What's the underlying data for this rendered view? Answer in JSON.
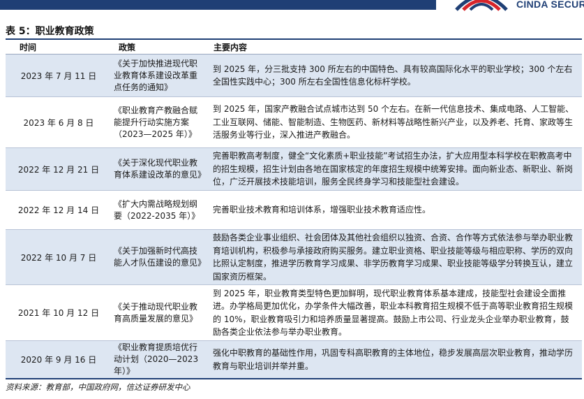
{
  "header": {
    "logo_text": "CINDA SECUR",
    "brand_colors": {
      "navy": "#1f3f75",
      "red": "#d7252b"
    }
  },
  "table": {
    "title": "表 5：职业教育政策",
    "columns": [
      "时间",
      "政策",
      "主要内容"
    ],
    "rows": [
      {
        "date": "2023 年 7 月 11 日",
        "policy": "《关于加快推进现代职业教育体系建设改革重点任务的通知》",
        "content": "到 2025 年，分三批支持 300 所左右的中国特色、具有较高国际化水平的职业学校；300 个左右全国性实践中心；300 所左右全国性信息化标杆学校。"
      },
      {
        "date": "2023 年 6 月 8 日",
        "policy": "《职业教育产教融合赋能提升行动实施方案（2023—2025 年）》",
        "content": "到 2025 年，国家产教融合试点城市达到 50 个左右。在新一代信息技术、集成电路、人工智能、工业互联网、储能、智能制造、生物医药、新材料等战略性新兴产业，以及养老、托育、家政等生活服务业等行业，深入推进产教融合。"
      },
      {
        "date": "2022 年 12 月 21 日",
        "policy": "《关于深化现代职业教育体系建设改革的意见》",
        "content": "完善职教高考制度，健全“文化素质+职业技能”考试招生办法，扩大应用型本科学校在职教高考中的招生规模，招生计划由各地在国家核定的年度招生规模中统筹安排。面向新业态、新职业、新岗位，广泛开展技术技能培训，服务全民终身学习和技能型社会建设。"
      },
      {
        "date": "2022 年 12 月 14 日",
        "policy": "《扩大内需战略规划纲要（2022-2035 年）》",
        "content": "完善职业技术教育和培训体系，增强职业技术教育适应性。"
      },
      {
        "date": "2022 年 10 月 7 日",
        "policy": "《关于加强新时代高技能人才队伍建设的意见》",
        "content": "鼓励各类企业事业组织、社会团体及其他社会组织以独资、合资、合作等方式依法参与举办职业教育培训机构，积极参与承接政府购买服务。建立职业资格、职业技能等级与相应职称、学历的双向比照认定制度，推进学历教育学习成果、非学历教育学习成果、职业技能等级学分转换互认，建立国家资历框架。"
      },
      {
        "date": "2021 年 10 月 12 日",
        "policy": "《关于推动现代职业教育高质量发展的意见》",
        "content": "到 2025 年，职业教育类型特色更加鲜明，现代职业教育体系基本建成，技能型社会建设全面推进。办学格局更加优化，办学条件大幅改善，职业本科教育招生规模不低于高等职业教育招生规模的 10%，职业教育吸引力和培养质量显著提高。鼓励上市公司、行业龙头企业举办职业教育，鼓励各类企业依法参与举办职业教育。"
      },
      {
        "date": "2020 年 9 月 16 日",
        "policy": "《职业教育提质培优行动计划（2020—2023 年）》",
        "content": "强化中职教育的基础性作用，巩固专科高职教育的主体地位，稳步发展高层次职业教育，推动学历教育与职业培训并举并重。"
      }
    ]
  },
  "source": "资料来源：教育部，中国政府网，信达证券研发中心"
}
